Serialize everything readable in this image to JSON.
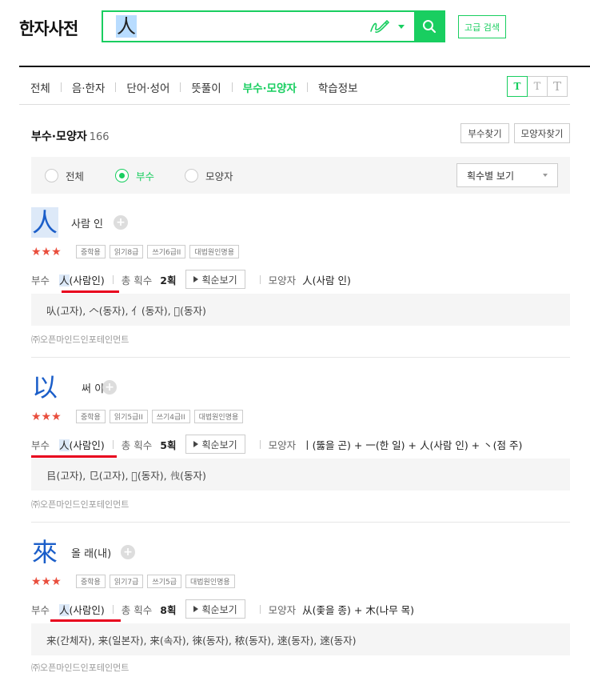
{
  "brand": "한자사전",
  "search": {
    "value": "人",
    "placeholder": "",
    "button_icon": "search-icon",
    "handwrite_icon": "pen-icon"
  },
  "advanced_search_label": "고급 검색",
  "tabs": [
    {
      "label": "전체",
      "active": false
    },
    {
      "label": "음·한자",
      "active": false
    },
    {
      "label": "단어·성어",
      "active": false
    },
    {
      "label": "뜻풀이",
      "active": false
    },
    {
      "label": "부수·모양자",
      "active": true
    },
    {
      "label": "학습정보",
      "active": false
    }
  ],
  "font_size_buttons": [
    "T",
    "T",
    "T"
  ],
  "section": {
    "title": "부수·모양자",
    "count": "166",
    "btn_radical_find": "부수찾기",
    "btn_shape_find": "모양자찾기"
  },
  "filter": {
    "options": [
      {
        "label": "전체",
        "active": false
      },
      {
        "label": "부수",
        "active": true
      },
      {
        "label": "모양자",
        "active": false
      }
    ],
    "select_value": "획수별 보기"
  },
  "labels": {
    "radical": "부수",
    "total_strokes": "총 획수",
    "stroke_order": "획순보기",
    "shape": "모양자"
  },
  "accent_color": "#19ce60",
  "entries": [
    {
      "hanja": "人",
      "meaning": "사람 인",
      "stars": "★★★",
      "badges": [
        "중학용",
        "읽기8급",
        "쓰기6급II",
        "대법원인명용"
      ],
      "radical_char": "人",
      "radical_name": "(사람인)",
      "strokes": "2획",
      "shape": "人(사람 인)",
      "related": "㕥(고자), 𠆢(동자), 亻(동자), 𡉞(동자)",
      "source": "㈜오픈마인드인포테인먼트"
    },
    {
      "hanja": "以",
      "meaning": "써 이",
      "stars": "★★★",
      "badges": [
        "중학용",
        "읽기5급II",
        "쓰기4급II",
        "대법원인명용"
      ],
      "radical_char": "人",
      "radical_name": "(사람인)",
      "strokes": "5획",
      "shape": "丨(뚫을 곤) + 一(한 일) + 人(사람 인) + 丶(점 주)",
      "related": "㠯(고자), 㔾(고자), 𢋠(동자), 𠈐(동자)",
      "source": "㈜오픈마인드인포테인먼트"
    },
    {
      "hanja": "來",
      "meaning": "올 래(내)",
      "stars": "★★★",
      "badges": [
        "중학용",
        "읽기7급",
        "쓰기5급",
        "대법원인명용"
      ],
      "radical_char": "人",
      "radical_name": "(사람인)",
      "strokes": "8획",
      "shape": "从(좇을 종) + 木(나무 목)",
      "related": "来(간체자), 来(일본자), 来(속자), 徠(동자), 秾(동자), 逨(동자), 逨(동자)",
      "source": "㈜오픈마인드인포테인먼트"
    }
  ]
}
